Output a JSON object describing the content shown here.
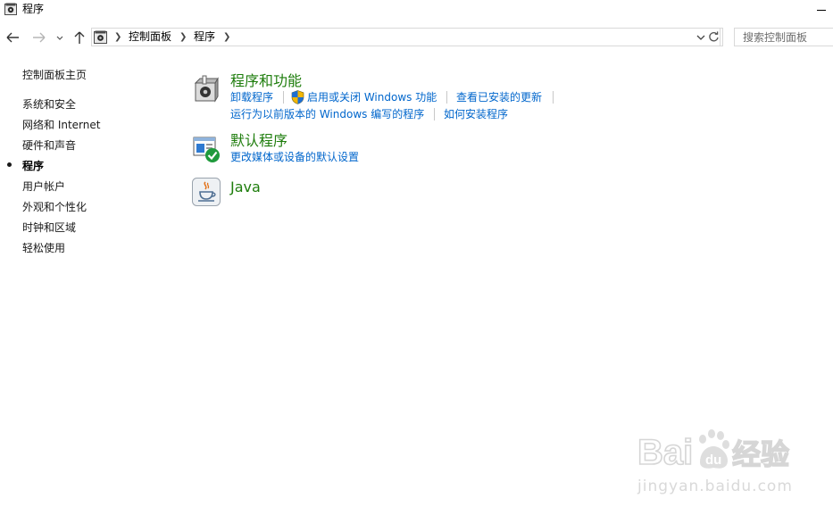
{
  "window": {
    "title": "程序"
  },
  "address": {
    "breadcrumbs": [
      "控制面板",
      "程序"
    ],
    "search_placeholder": "搜索控制面板"
  },
  "sidebar": {
    "home": "控制面板主页",
    "items": [
      {
        "label": "系统和安全",
        "current": false
      },
      {
        "label": "网络和 Internet",
        "current": false
      },
      {
        "label": "硬件和声音",
        "current": false
      },
      {
        "label": "程序",
        "current": true
      },
      {
        "label": "用户帐户",
        "current": false
      },
      {
        "label": "外观和个性化",
        "current": false
      },
      {
        "label": "时钟和区域",
        "current": false
      },
      {
        "label": "轻松使用",
        "current": false
      }
    ]
  },
  "categories": [
    {
      "title": "程序和功能",
      "icon": "programs-features-icon",
      "links": [
        "卸载程序",
        "启用或关闭 Windows 功能",
        "查看已安装的更新",
        "运行为以前版本的 Windows 编写的程序",
        "如何安装程序"
      ]
    },
    {
      "title": "默认程序",
      "icon": "default-programs-icon",
      "links": [
        "更改媒体或设备的默认设置"
      ]
    },
    {
      "title": "Java",
      "icon": "java-icon",
      "links": []
    }
  ],
  "watermark": {
    "brand": "Baidu经验",
    "url": "jingyan.baidu.com"
  },
  "colors": {
    "category_title": "#1e7d0c",
    "link": "#0066cc",
    "border": "#d9d9d9"
  }
}
